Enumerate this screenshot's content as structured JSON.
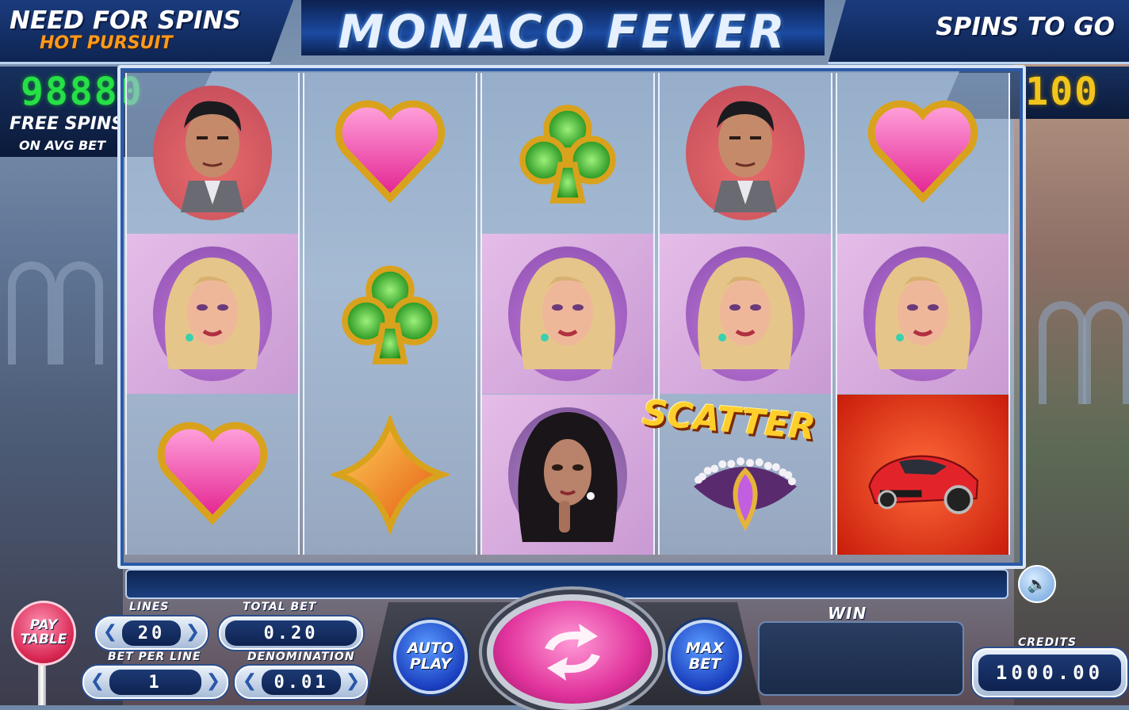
{
  "header": {
    "brand_line1": "NEED FOR SPINS",
    "brand_line2": "HOT PURSUIT",
    "title": "MONACO FEVER",
    "spins_to_go_label": "SPINS TO GO"
  },
  "free_spins": {
    "counter": "98880",
    "label_line1": "FREE SPINS",
    "label_line2": "ON AVG BET"
  },
  "spins_to_go": {
    "counter": "100"
  },
  "reels": [
    [
      "man",
      "blonde",
      "heart"
    ],
    [
      "heart",
      "club",
      "diamond"
    ],
    [
      "club",
      "blonde",
      "brunette"
    ],
    [
      "man",
      "blonde",
      "scatter"
    ],
    [
      "heart",
      "blonde",
      "car"
    ]
  ],
  "scatter_label": "SCATTER",
  "controls": {
    "paytable_label": "PAY\nTABLE",
    "lines_label": "LINES",
    "lines_value": "20",
    "total_bet_label": "TOTAL BET",
    "total_bet_value": "0.20",
    "bet_per_line_label": "BET PER LINE",
    "bet_per_line_value": "1",
    "denomination_label": "DENOMINATION",
    "denomination_value": "0.01",
    "autoplay_label": "AUTO\nPLAY",
    "maxbet_label": "MAX\nBET",
    "win_label": "WIN",
    "win_value": "",
    "credits_label": "CREDITS",
    "credits_value": "1000.00"
  },
  "colors": {
    "free_spins_digits": "#25e046",
    "spins_to_go_digits": "#f2c51c",
    "spin_button": "#e1339c",
    "blue_button": "#1a3fbf",
    "scatter_text": "#ffce2b"
  }
}
